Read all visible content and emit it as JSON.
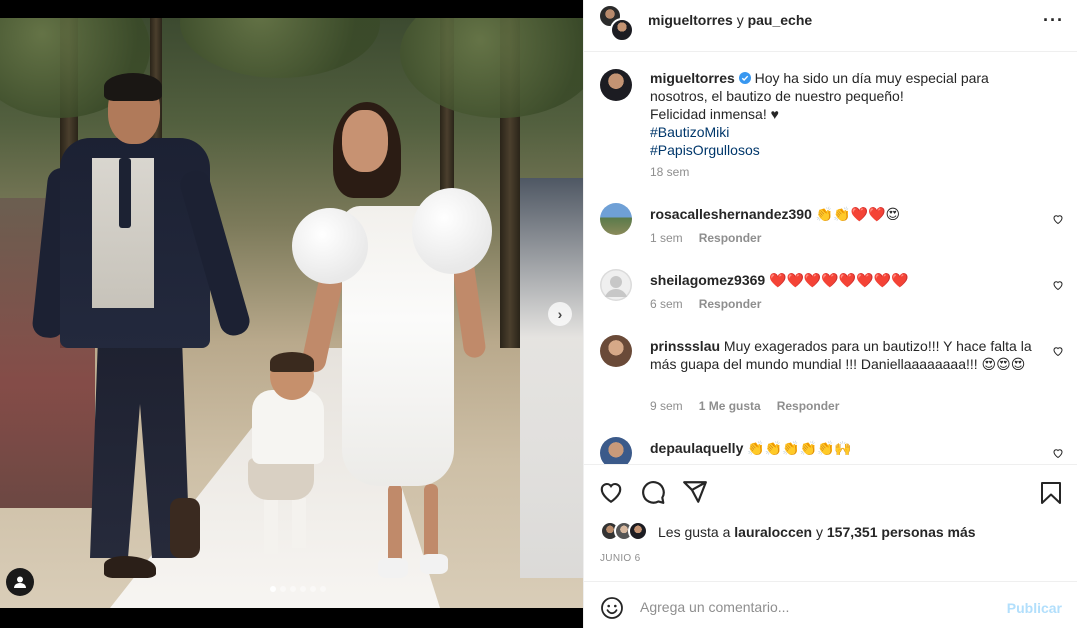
{
  "header": {
    "user1": "migueltorres",
    "conjunction": "y",
    "user2": "pau_eche",
    "more_icon": "more-horizontal-icon"
  },
  "caption": {
    "username": "migueltorres",
    "verified_icon": "verified-badge-icon",
    "text_line1": "Hoy ha sido un día muy especial para nosotros, el bautizo de nuestro pequeño!",
    "text_line2": "Felicidad inmensa! ♥",
    "hashtag1": "#BautizoMiki",
    "hashtag2": "#PapisOrgullosos",
    "time": "18 sem"
  },
  "comments": [
    {
      "username": "rosacalleshernandez390",
      "text": "👏👏❤️❤️😍",
      "time": "1 sem",
      "reply": "Responder",
      "likes": ""
    },
    {
      "username": "sheilagomez9369",
      "text": "❤️❤️❤️❤️❤️❤️❤️❤️",
      "time": "6 sem",
      "reply": "Responder",
      "likes": ""
    },
    {
      "username": "prinssslau",
      "text": "Muy exagerados para un bautizo!!! Y hace falta la más guapa del mundo mundial !!! Daniellaaaaaaaa!!! 😍😍😍",
      "time": "9 sem",
      "likes": "1 Me gusta",
      "reply": "Responder"
    },
    {
      "username": "depaulaquelly",
      "text": "👏👏👏👏👏🙌",
      "time": "",
      "reply": "",
      "likes": ""
    }
  ],
  "likes": {
    "prefix": "Les gusta a",
    "user": "lauraloccen",
    "connector": "y",
    "count": "157,351 personas más"
  },
  "date": "JUNIO 6",
  "add_comment": {
    "placeholder": "Agrega un comentario...",
    "publish_label": "Publicar",
    "emoji_icon": "smiley-icon"
  },
  "actions": {
    "like_icon": "heart-icon",
    "comment_icon": "comment-icon",
    "share_icon": "send-icon",
    "save_icon": "bookmark-icon"
  },
  "colors": {
    "link": "#00376b",
    "muted": "#8e8e8e",
    "publish_disabled": "#b2dffc",
    "verified": "#3897f0"
  },
  "carousel": {
    "slides": 6,
    "active": 1
  }
}
